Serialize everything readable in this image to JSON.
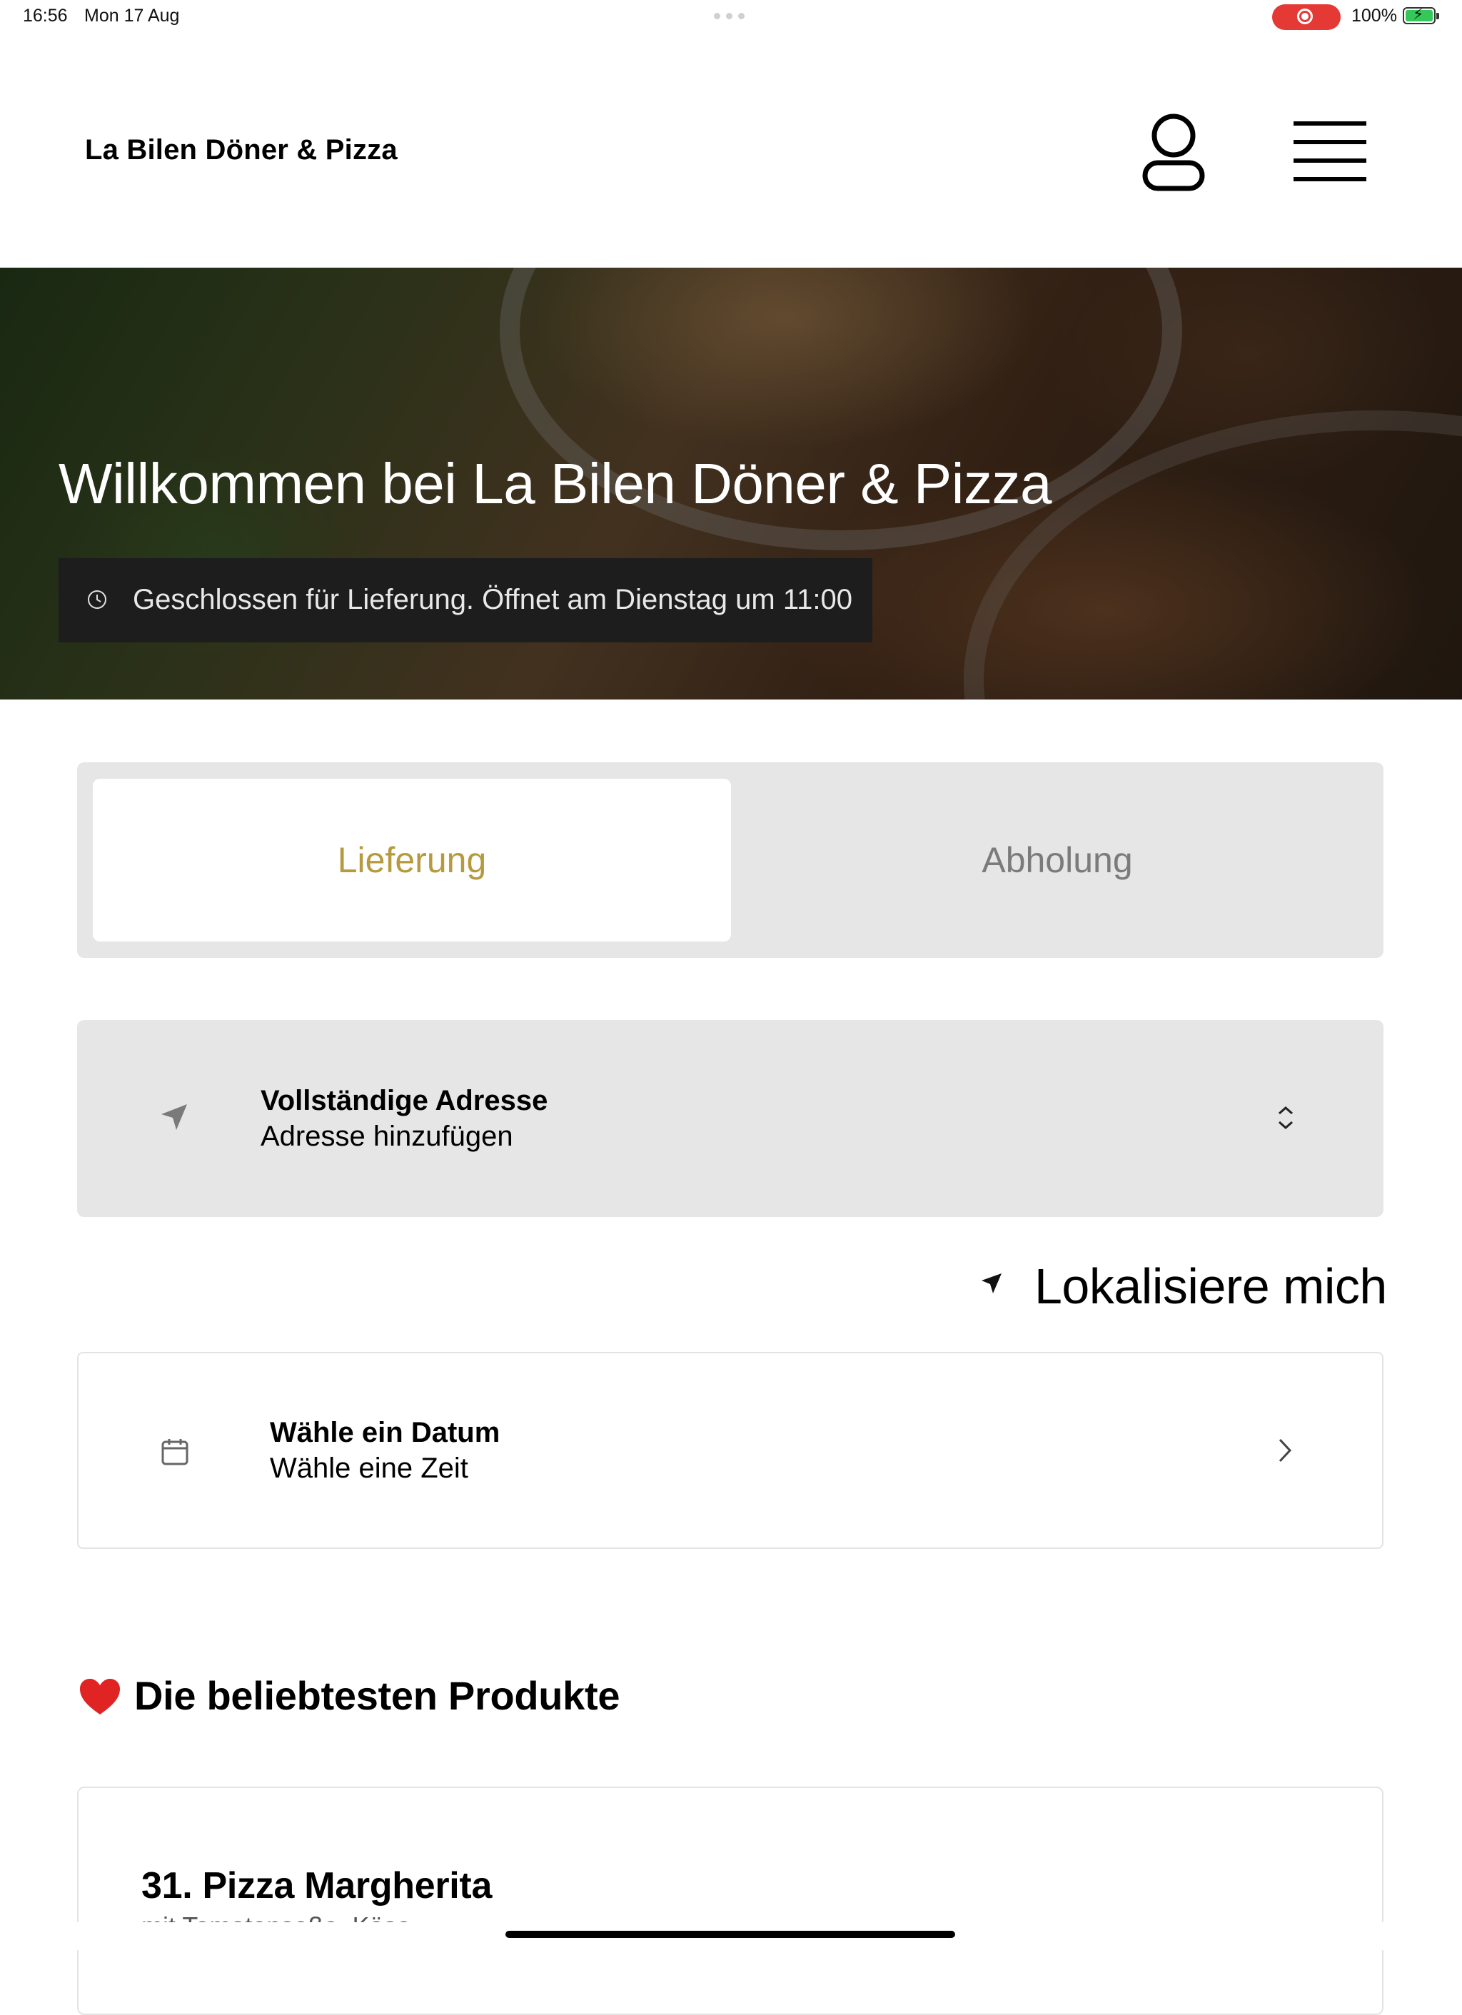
{
  "status_bar": {
    "time": "16:56",
    "date": "Mon 17 Aug",
    "battery": "100%",
    "recording_color": "#e53935",
    "battery_color": "#34c759"
  },
  "header": {
    "brand": "La Bilen Döner & Pizza",
    "account_icon": "user-icon",
    "menu_icon": "hamburger-menu-icon"
  },
  "hero": {
    "title": "Willkommen bei La Bilen Döner & Pizza",
    "closed_notice": "Geschlossen für Lieferung. Öffnet am Dienstag um 11:00",
    "notice_icon": "clock-icon"
  },
  "order_mode": {
    "delivery": "Lieferung",
    "pickup": "Abholung",
    "selected": "Lieferung",
    "accent_color": "#b69a3e"
  },
  "address": {
    "title": "Vollständige Adresse",
    "subtitle": "Adresse hinzufügen",
    "icon": "location-arrow-icon"
  },
  "locate": {
    "label": "Lokalisiere mich",
    "icon": "location-arrow-icon"
  },
  "schedule": {
    "title": "Wähle ein Datum",
    "subtitle": "Wähle eine Zeit",
    "icon": "calendar-icon"
  },
  "popular": {
    "title": "Die beliebtesten Produkte",
    "icon": "heart-icon",
    "products": [
      {
        "name": "31. Pizza Margherita",
        "description": "mit Tomatensoße, Käse"
      }
    ]
  }
}
